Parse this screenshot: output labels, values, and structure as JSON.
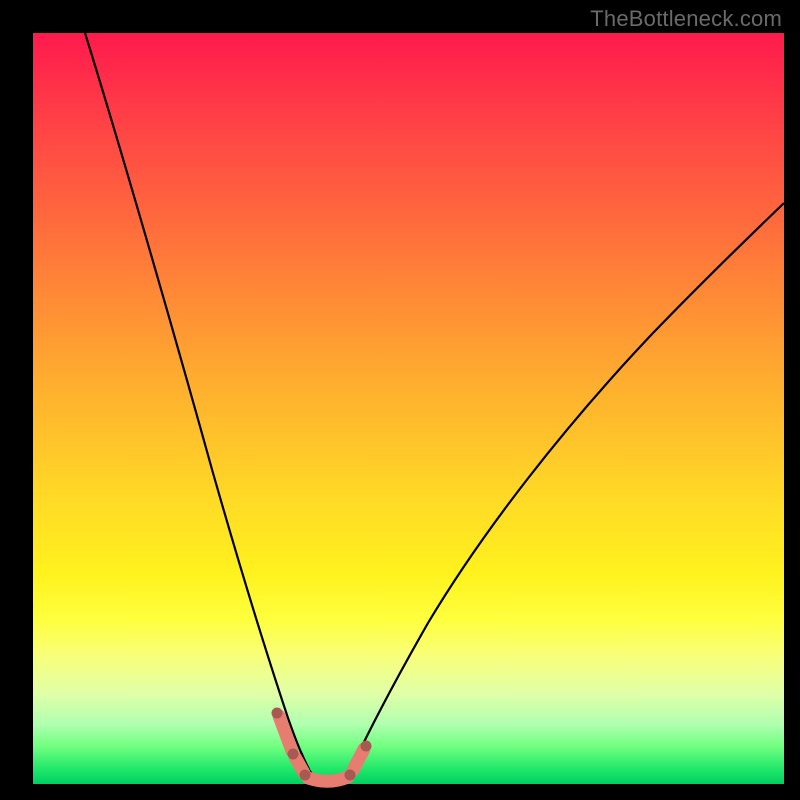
{
  "watermark": "TheBottleneck.com",
  "colors": {
    "salmon": "#e77c70",
    "salmon_dark": "#a85a52",
    "curve": "#000000"
  },
  "chart_data": {
    "type": "line",
    "title": "",
    "xlabel": "",
    "ylabel": "",
    "xlim": [
      0,
      100
    ],
    "ylim": [
      0,
      100
    ],
    "grid": false,
    "series": [
      {
        "name": "left-branch",
        "x": [
          7,
          10,
          14,
          18,
          22,
          25,
          28,
          30,
          32,
          33.5,
          35,
          36
        ],
        "y": [
          100,
          89,
          75,
          60,
          45,
          33,
          22,
          14,
          8,
          4,
          1.5,
          0.5
        ]
      },
      {
        "name": "right-branch",
        "x": [
          41,
          43,
          46,
          50,
          55,
          62,
          70,
          80,
          90,
          100
        ],
        "y": [
          0.5,
          3,
          8,
          15,
          24,
          36,
          48,
          60,
          70,
          78
        ]
      },
      {
        "name": "valley-floor",
        "x": [
          36,
          37.5,
          39,
          40,
          41
        ],
        "y": [
          0.5,
          0.2,
          0.2,
          0.3,
          0.5
        ]
      }
    ],
    "highlight_segments": [
      {
        "side": "left",
        "x": [
          32.0,
          33.8
        ],
        "y": [
          8.0,
          3.5
        ]
      },
      {
        "side": "left",
        "x": [
          34.2,
          35.2
        ],
        "y": [
          2.6,
          1.2
        ]
      },
      {
        "side": "floor",
        "x": [
          35.8,
          40.8
        ],
        "y": [
          0.5,
          0.5
        ]
      },
      {
        "side": "right",
        "x": [
          41.6,
          43.2
        ],
        "y": [
          1.2,
          3.4
        ]
      }
    ],
    "highlight_points": [
      {
        "x": 32.0,
        "y": 8.0
      },
      {
        "x": 33.9,
        "y": 3.2
      },
      {
        "x": 35.3,
        "y": 1.2
      },
      {
        "x": 41.1,
        "y": 0.7
      },
      {
        "x": 43.5,
        "y": 3.8
      }
    ]
  }
}
